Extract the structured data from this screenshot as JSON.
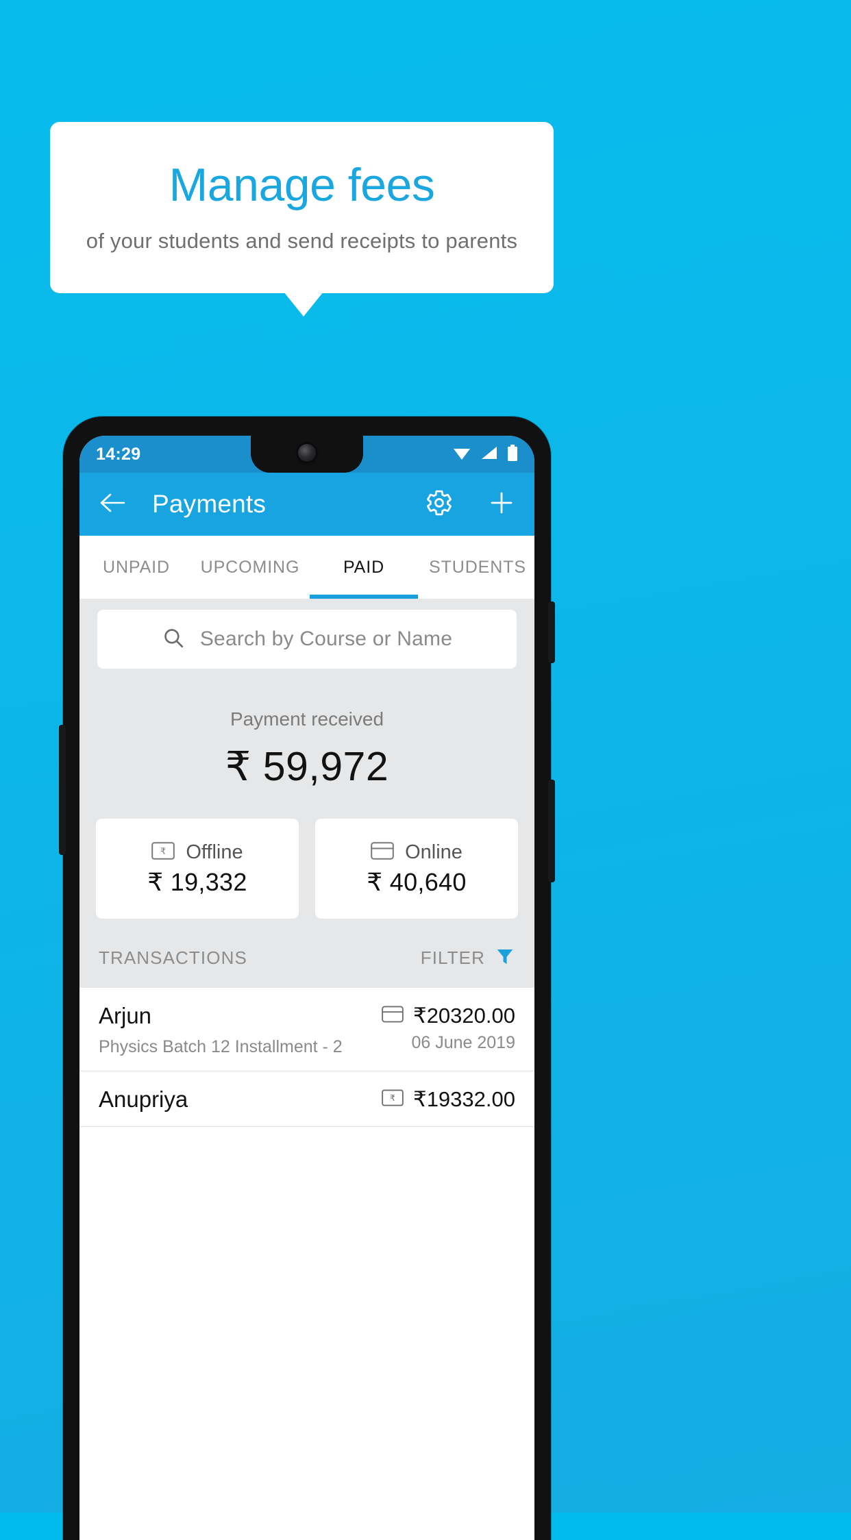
{
  "promo": {
    "title": "Manage fees",
    "subtitle": "of your students and send receipts to parents",
    "title_color": "#1AA7E0",
    "background_color": "#0CB8EA",
    "card_color": "#FFFFFF"
  },
  "phone": {
    "status_bar": {
      "time": "14:29",
      "wifi_icon": "wifi-icon",
      "signal_icon": "signal-icon",
      "battery_icon": "battery-icon",
      "background_color": "#1B8FCC"
    },
    "app_bar": {
      "back_icon": "back-arrow-icon",
      "title": "Payments",
      "settings_icon": "gear-icon",
      "add_icon": "plus-icon",
      "background_color": "#17A4E0"
    },
    "tabs": [
      {
        "label": "UNPAID",
        "active": false
      },
      {
        "label": "UPCOMING",
        "active": false
      },
      {
        "label": "PAID",
        "active": true
      },
      {
        "label": "STUDENTS",
        "active": false
      }
    ],
    "tab_indicator_color": "#1AA0DC",
    "search": {
      "icon": "search-icon",
      "placeholder": "Search by Course or Name",
      "value": ""
    },
    "summary": {
      "label": "Payment received",
      "amount": "₹ 59,972"
    },
    "breakdown": [
      {
        "icon": "cash-note-icon",
        "label": "Offline",
        "amount": "₹ 19,332"
      },
      {
        "icon": "credit-card-icon",
        "label": "Online",
        "amount": "₹ 40,640"
      }
    ],
    "list_header": {
      "title": "TRANSACTIONS",
      "filter_label": "FILTER",
      "filter_icon": "funnel-icon",
      "filter_icon_color": "#1AA0DC"
    },
    "transactions": [
      {
        "name": "Arjun",
        "description": "Physics Batch 12 Installment - 2",
        "amount": "₹20320.00",
        "date": "06 June 2019",
        "method_icon": "credit-card-icon"
      },
      {
        "name": "Anupriya",
        "description": "",
        "amount": "₹19332.00",
        "date": "",
        "method_icon": "cash-note-icon"
      }
    ]
  }
}
